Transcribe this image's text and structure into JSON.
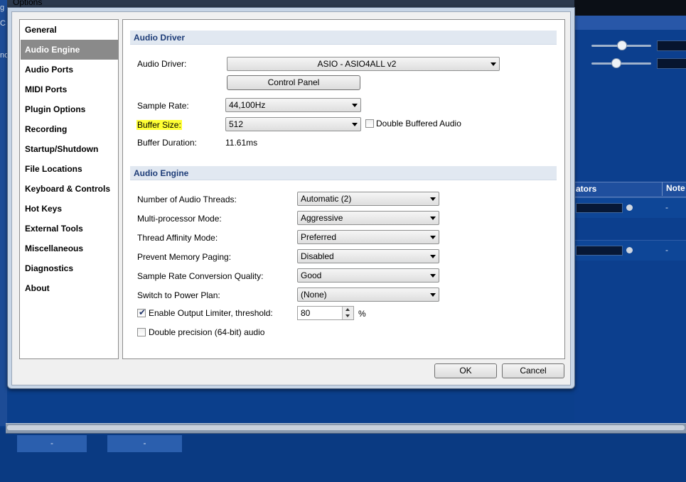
{
  "window": {
    "title": "Options"
  },
  "nav": {
    "items": [
      {
        "label": "General"
      },
      {
        "label": "Audio Engine"
      },
      {
        "label": "Audio Ports"
      },
      {
        "label": "MIDI Ports"
      },
      {
        "label": "Plugin Options"
      },
      {
        "label": "Recording"
      },
      {
        "label": "Startup/Shutdown"
      },
      {
        "label": "File Locations"
      },
      {
        "label": "Keyboard & Controls"
      },
      {
        "label": "Hot Keys"
      },
      {
        "label": "External Tools"
      },
      {
        "label": "Miscellaneous"
      },
      {
        "label": "Diagnostics"
      },
      {
        "label": "About"
      }
    ],
    "selected": "Audio Engine"
  },
  "audio_driver": {
    "section_title": "Audio Driver",
    "driver_label": "Audio Driver:",
    "driver_value": "ASIO - ASIO4ALL v2",
    "control_panel_label": "Control Panel",
    "sample_rate_label": "Sample Rate:",
    "sample_rate_value": "44,100Hz",
    "buffer_size_label": "Buffer Size:",
    "buffer_size_value": "512",
    "double_buffered_label": "Double Buffered Audio",
    "double_buffered_checked": false,
    "buffer_duration_label": "Buffer Duration:",
    "buffer_duration_value": "11.61ms",
    "highlight_color": "#ffff33"
  },
  "audio_engine": {
    "section_title": "Audio Engine",
    "threads_label": "Number of Audio Threads:",
    "threads_value": "Automatic (2)",
    "mp_mode_label": "Multi-processor Mode:",
    "mp_mode_value": "Aggressive",
    "affinity_label": "Thread Affinity Mode:",
    "affinity_value": "Preferred",
    "paging_label": "Prevent Memory Paging:",
    "paging_value": "Disabled",
    "src_quality_label": "Sample Rate Conversion Quality:",
    "src_quality_value": "Good",
    "power_plan_label": "Switch to Power Plan:",
    "power_plan_value": "(None)",
    "limiter_label": "Enable Output Limiter, threshold:",
    "limiter_checked": true,
    "limiter_value": "80",
    "limiter_unit": "%",
    "double_precision_label": "Double precision (64-bit) audio",
    "double_precision_checked": false
  },
  "buttons": {
    "ok": "OK",
    "cancel": "Cancel"
  },
  "background": {
    "left_edge_chars": [
      "g",
      "C",
      "no"
    ],
    "header_col1": "ators",
    "header_col2": "Note",
    "row_dash": "-",
    "bottom_btn1": "-",
    "bottom_btn2": "-"
  },
  "colors": {
    "accent_blue": "#0b3f8c",
    "section_text": "#1e3d78",
    "nav_selected_bg": "#8a8a8a"
  }
}
